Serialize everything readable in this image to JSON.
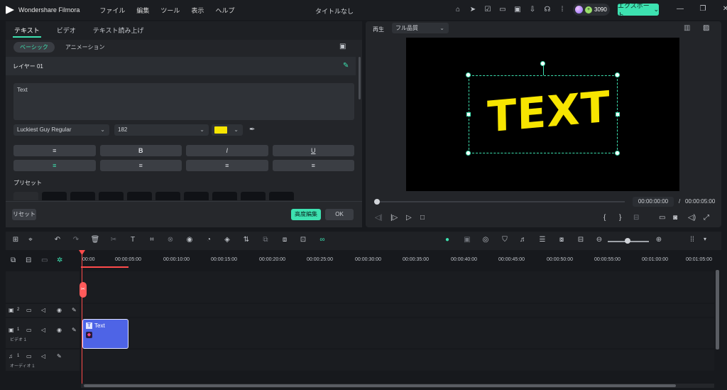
{
  "app": {
    "name": "Wondershare Filmora",
    "doc_title": "タイトルなし"
  },
  "menu": [
    "ファイル",
    "編集",
    "ツール",
    "表示",
    "ヘルプ"
  ],
  "toolbar": {
    "credits": "3090",
    "export_label": "エクスポート"
  },
  "left_panel": {
    "tabs": [
      "テキスト",
      "ビデオ",
      "テキスト読み上げ"
    ],
    "subtabs": [
      "ベーシック",
      "アニメーション"
    ],
    "layer_label": "レイヤー 01",
    "text_value": "Text",
    "font": "Luckiest Guy Regular",
    "size": "182",
    "color": "#f7e500",
    "format_buttons": [
      "≡",
      "B",
      "I",
      "U"
    ],
    "align_buttons": [
      "≡",
      "≡",
      "≡",
      "≡"
    ],
    "preset_label": "プリセット",
    "reset": "リセット",
    "advanced": "高度編集",
    "ok": "OK"
  },
  "player": {
    "play_label": "再生",
    "quality": "フル品質",
    "preview_text": "TEXT",
    "current_time": "00:00:00:00",
    "separator": "/",
    "total_time": "00:00:05:00"
  },
  "timeline": {
    "ruler": [
      "00:00",
      "00:00:05:00",
      "00:00:10:00",
      "00:00:15:00",
      "00:00:20:00",
      "00:00:25:00",
      "00:00:30:00",
      "00:00:35:00",
      "00:00:40:00",
      "00:00:45:00",
      "00:00:50:00",
      "00:00:55:00",
      "00:01:00:00",
      "00:01:05:00"
    ],
    "tracks": [
      {
        "num": "2",
        "name": ""
      },
      {
        "num": "1",
        "name": "ビデオ 1"
      },
      {
        "num": "1",
        "name": "オーディオ 1"
      }
    ],
    "clip_label": "Text"
  }
}
